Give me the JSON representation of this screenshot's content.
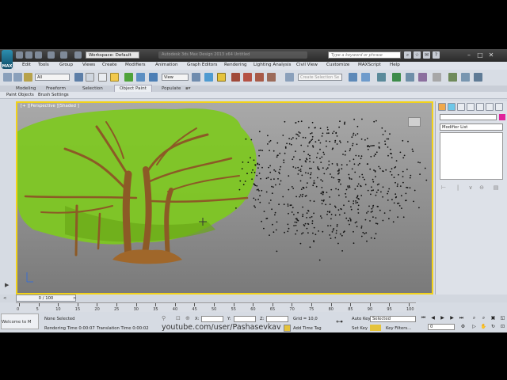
{
  "titlebar": {
    "logo": "MAX",
    "workspace": "Workspace: Default",
    "window_title": "Autodesk 3ds Max Design 2013 x64    Untitled",
    "search_placeholder": "Type a keyword or phrase"
  },
  "menu": [
    "Edit",
    "Tools",
    "Group",
    "Views",
    "Create",
    "Modifiers",
    "Animation",
    "Graph Editors",
    "Rendering",
    "Lighting Analysis",
    "Civil View",
    "Customize",
    "MAXScript",
    "Help"
  ],
  "toolbar": {
    "selection_filter": "All",
    "reference_coord": "View",
    "named_selection": "Create Selection Se"
  },
  "ribbon": {
    "tabs": [
      "Modeling",
      "Freeform",
      "Selection",
      "Object Paint",
      "Populate"
    ],
    "active_tab": "Object Paint",
    "sub_items": [
      "Paint Objects",
      "Brush Settings"
    ]
  },
  "viewport": {
    "label": "[+ ][Perspective ][Shaded ]",
    "accent": "#f2d21a",
    "foliage": "#7ec91f"
  },
  "command_panel": {
    "modifier_list": "Modifier List",
    "color_swatch": "#e0219a"
  },
  "timeline": {
    "frame": "0 / 100",
    "ticks": [
      "0",
      "5",
      "10",
      "15",
      "20",
      "25",
      "30",
      "35",
      "40",
      "45",
      "50",
      "55",
      "60",
      "65",
      "70",
      "75",
      "80",
      "85",
      "90",
      "95",
      "100"
    ]
  },
  "status": {
    "selection": "None Selected",
    "render_time": "Rendering Time  0:00:07",
    "translation_time": "Translation Time  0:00:02",
    "x_label": "X:",
    "y_label": "Y:",
    "z_label": "Z:",
    "grid": "Grid = 10,0",
    "add_time_tag": "Add Time Tag",
    "auto_key": "Auto Key",
    "auto_key_mode": "Selected",
    "set_key": "Set Key",
    "key_filters": "Key Filters...",
    "frame_field": "0",
    "welcome": "Welcome to M",
    "welcome_note": "Click or click"
  },
  "watermark": {
    "prefix": "youtube.com/user/",
    "name": "Pashasevkav"
  }
}
